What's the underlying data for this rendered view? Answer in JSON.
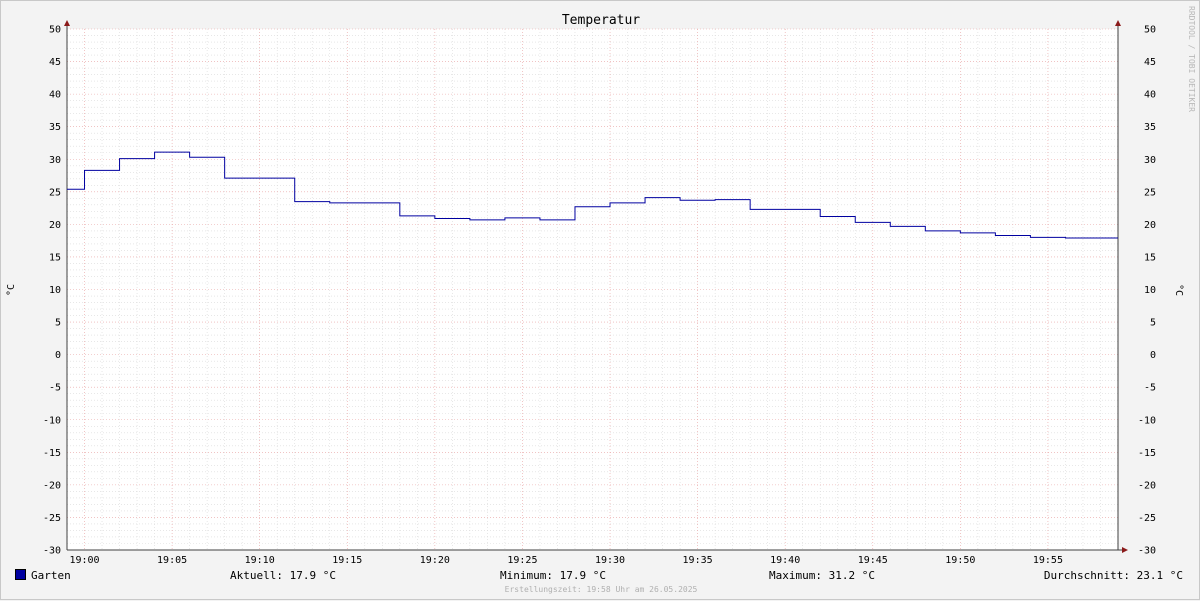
{
  "chart_data": {
    "type": "line",
    "title": "Temperatur",
    "ylabel_left": "°C",
    "ylabel_right": "°C",
    "ylim": [
      -30,
      50
    ],
    "y_ticks": [
      50,
      45,
      40,
      35,
      30,
      25,
      20,
      15,
      10,
      5,
      0,
      -5,
      -10,
      -15,
      -20,
      -25,
      -30
    ],
    "x_tick_labels": [
      "19:00",
      "19:05",
      "19:10",
      "19:15",
      "19:20",
      "19:25",
      "19:30",
      "19:35",
      "19:40",
      "19:45",
      "19:50",
      "19:55"
    ],
    "x_tick_minutes": [
      0,
      5,
      10,
      15,
      20,
      25,
      30,
      35,
      40,
      45,
      50,
      55
    ],
    "xlim_minutes": [
      -1,
      59
    ],
    "series": [
      {
        "name": "Garten",
        "color": "#0000a0",
        "step": true,
        "x_minutes": [
          -1,
          0,
          2,
          4,
          6,
          8,
          10,
          12,
          14,
          16,
          18,
          20,
          22,
          24,
          26,
          28,
          30,
          32,
          34,
          36,
          38,
          40,
          42,
          44,
          46,
          48,
          50,
          52,
          54,
          56,
          58,
          59
        ],
        "values": [
          25.4,
          28.3,
          30.1,
          31.1,
          30.3,
          27.1,
          27.1,
          23.5,
          23.3,
          23.3,
          21.3,
          20.9,
          20.7,
          21.0,
          20.7,
          22.7,
          23.3,
          24.1,
          23.7,
          23.8,
          22.3,
          22.3,
          21.2,
          20.3,
          19.7,
          19.0,
          18.7,
          18.3,
          18.0,
          17.9,
          17.9,
          17.9
        ]
      }
    ]
  },
  "legend": {
    "series_label": "Garten",
    "current": "Aktuell: 17.9 °C",
    "minimum": "Minimum: 17.9 °C",
    "maximum": "Maximum: 31.2 °C",
    "average": "Durchschnitt: 23.1 °C"
  },
  "watermark": "RRDTOOL / TOBI OETIKER",
  "footer": "Erstellungszeit: 19:58 Uhr am 26.05.2025"
}
